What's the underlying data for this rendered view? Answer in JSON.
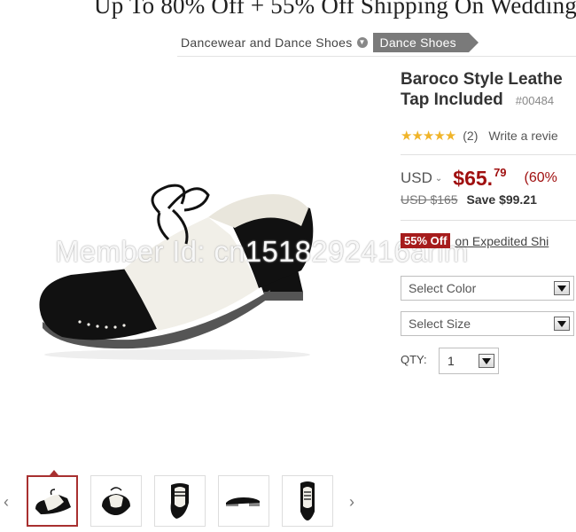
{
  "banner": {
    "text": "Up To 80% Off + 55% Off Shipping On Wedding"
  },
  "breadcrumb": {
    "parent": "Dancewear and Dance Shoes",
    "current": "Dance Shoes"
  },
  "product": {
    "title_line1": "Baroco Style Leathe",
    "title_line2": "Tap Included",
    "sku": "#00484",
    "rating": {
      "stars": "★★★★★",
      "count": "(2)",
      "write_review": "Write a revie"
    },
    "currency": "USD",
    "price_main": "$65.",
    "price_cents": "79",
    "discount": "(60%",
    "original_price": "USD $165",
    "save": "Save $99.21",
    "promo_badge": "55% Off",
    "promo_text": "on Expedited Shi",
    "select_color": "Select Color",
    "select_size": "Select Size",
    "qty_label": "QTY:",
    "qty_value": "1"
  },
  "watermark": "Member Id: cn1518292416arlm",
  "thumbnails": {
    "prev": "‹",
    "next": "›",
    "count": 5,
    "active_index": 0
  },
  "colors": {
    "price_red": "#a01010",
    "promo_red": "#a61c1c",
    "star_gold": "#f0b429",
    "breadcrumb_gray": "#7a7a7a"
  }
}
